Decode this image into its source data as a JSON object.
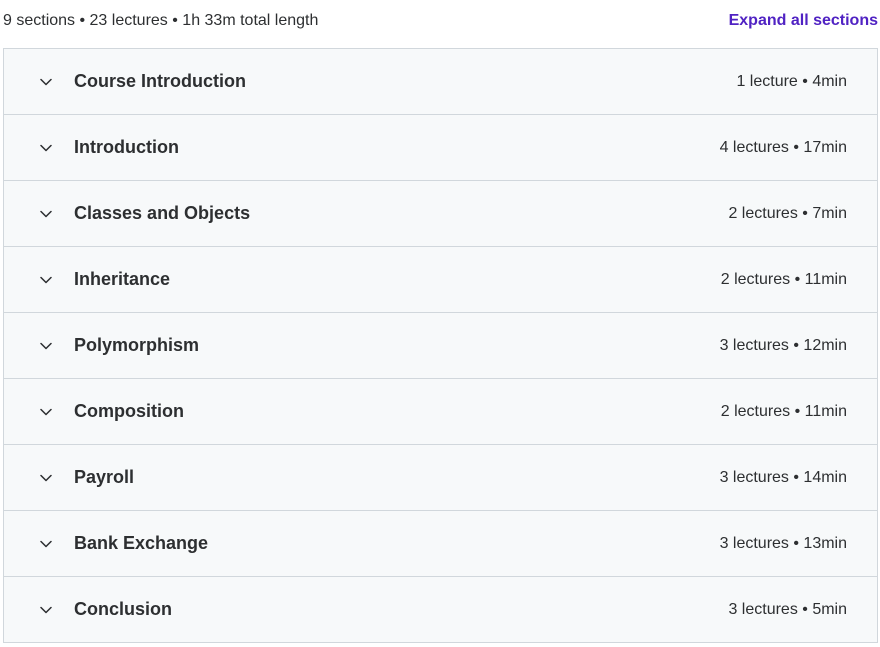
{
  "header": {
    "summary": "9 sections • 23 lectures • 1h 33m total length",
    "expand_label": "Expand all sections"
  },
  "colors": {
    "accent": "#5022c3",
    "row_background": "#f7f9fa",
    "border": "#d1d7dc",
    "text": "#2d2f31"
  },
  "icons": {
    "row_toggle": "chevron-down-icon"
  },
  "sections": [
    {
      "title": "Course Introduction",
      "meta": "1 lecture • 4min"
    },
    {
      "title": "Introduction",
      "meta": "4 lectures • 17min"
    },
    {
      "title": "Classes and Objects",
      "meta": "2 lectures • 7min"
    },
    {
      "title": "Inheritance",
      "meta": "2 lectures • 11min"
    },
    {
      "title": "Polymorphism",
      "meta": "3 lectures • 12min"
    },
    {
      "title": "Composition",
      "meta": "2 lectures • 11min"
    },
    {
      "title": "Payroll",
      "meta": "3 lectures • 14min"
    },
    {
      "title": "Bank Exchange",
      "meta": "3 lectures • 13min"
    },
    {
      "title": "Conclusion",
      "meta": "3 lectures • 5min"
    }
  ]
}
